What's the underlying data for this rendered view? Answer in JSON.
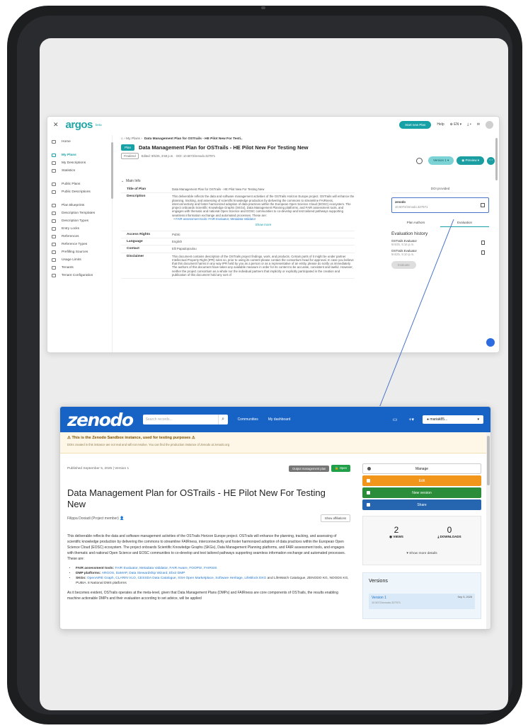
{
  "argos": {
    "logo": "argos",
    "beta": "beta",
    "start_plan": "Start new Plan",
    "help": "Help",
    "language": "EN",
    "sidebar": [
      {
        "label": "Home"
      },
      {
        "label": "My Plans",
        "active": true
      },
      {
        "label": "My Descriptions"
      },
      {
        "label": "Statistics"
      },
      {
        "label": "Public Plans"
      },
      {
        "label": "Public Descriptions"
      },
      {
        "label": "Plan Blueprints"
      },
      {
        "label": "Description Templates"
      },
      {
        "label": "Description Types"
      },
      {
        "label": "Entry Locks"
      },
      {
        "label": "References"
      },
      {
        "label": "Reference Types"
      },
      {
        "label": "Prefilling Sources"
      },
      {
        "label": "Usage Limits"
      },
      {
        "label": "Tenants"
      },
      {
        "label": "Tenant Configuration"
      }
    ],
    "breadcrumb": {
      "root": "My Plans",
      "current": "Data Management Plan for OSTrails - HE Pilot New For Testi.."
    },
    "plan_tag": "Plan",
    "plan_title": "Data Management Plan for OSTrails - HE Pilot New For Testing New",
    "status": "Finalized",
    "edited": "Edited: 9/5/25, 3:58 p.m.",
    "doi_line": "DOI: 10.5072/zenodo.327971",
    "version_btn": "Version 1",
    "preview_btn": "Preview",
    "main_info": "Main Info",
    "rows": [
      {
        "key": "Title of Plan",
        "value": "Data Management Plan for OSTrails - HE Pilot New For Testing New"
      },
      {
        "key": "Description",
        "value": "This deliverable reflects the data and software management activities of the OSTrails Horizon Europe project. OSTrails will enhance the planning, tracking, and assessing of scientific knowledge production by delivering the commons to streamline FAIRness, interconnectivity and foster harmonized adoption of data practices within the European Open Science Cloud (EOSC) ecosystem. The project onboards Scientific Knowledge Graphs (SKGs), Data Management Planning platforms, and FAIR assessment tools, and engages with thematic and national Open Science and EOSC communities to co-develop and test tailored pathways supporting seamless information exchange and automated processes. These are:",
        "bullet": "FAIR assessment tools: FAIR Evaluator, Metadata Validator"
      },
      {
        "key": "Access Rights",
        "value": "Public"
      },
      {
        "key": "Language",
        "value": "English"
      },
      {
        "key": "Contact",
        "value": "Elli Papadopoulou"
      },
      {
        "key": "Disclaimer",
        "value": "This document contains description of the OSTrails project findings, work, and products. Certain parts of it might be under partner Intellectual Property Right (IPR) rules so, prior to using its content please contact the consortium head for approval. In case you believe that this document harms in any way IPR held by you as a person or as a representative of an entity, please do notify us immediately. The authors of this document have taken any available measure in order for its content to be accurate, consistent and lawful. However, neither the project consortium as a whole nor the individual partners that implicitly or explicitly participated in the creation and publication of this document hold any sort of"
      }
    ],
    "show_more": "Show more",
    "doi_panel": {
      "header": "DOI provided",
      "repo": "zenodo",
      "doi": "10.5072/zenodo.327971",
      "tab_authors": "Plan Authors",
      "tab_eval": "Evaluation",
      "history_title": "Evaluation history",
      "items": [
        {
          "name": "OSTrails Evaluator",
          "date": "9/4/25, 5:16 p.m."
        },
        {
          "name": "OSTrails Evaluator",
          "date": "9/4/25, 5:10 p.m."
        }
      ],
      "evaluate_btn": "Evaluate"
    }
  },
  "zenodo": {
    "logo": "zenodo",
    "search_placeholder": "Search records...",
    "nav_communities": "Communities",
    "nav_dashboard": "My dashboard",
    "user": "mariak85...",
    "banner_title": "This is the Zenodo Sandbox instance, used for testing purposes",
    "banner_sub": "DOIs created in this instance are not real and will not resolve. You can find the production instance of Zenodo at zenodo.org",
    "published": "Published September 5, 2025 | Version 1",
    "badge_type": "Output management plan",
    "badge_open": "Open",
    "title": "Data Management Plan for OSTrails - HE Pilot New For Testing New",
    "creator": "Filippa Doxiadi (Project member)",
    "show_affiliations": "Show affiliations",
    "description": "This deliverable reflects the data and software management activities of the OSTrails Horizon Europe project. OSTrails will enhance the planning, tracking, and assessing of scientific knowledge production by delivering the commons to streamline FAIRness, interconnectivity and foster harmonized adoption of data practices within the European Open Science Cloud (EOSC) ecosystem. The project onboards Scientific Knowledge Graphs (SKGs), Data Management Planning platforms, and FAIR assessment tools, and engages with thematic and national Open Science and EOSC communities to co-develop and test tailored pathways supporting seamless information exchange and automated processes. These are:",
    "bullets": [
      {
        "lead": "FAIR assessment tools: ",
        "links": "FAIR Evaluator, Metadata Validator, FAIR Aware, FOOPS!, FAIRSIS"
      },
      {
        "lead": "DMP platforms: ",
        "links": "ARGOS, DaMAP, Data Stewardship Wizard, Elixir DMP"
      },
      {
        "lead": "SKGs: ",
        "links": "OpenAIRE Graph, CLARIN VLO, CESSDA Data Catalogue, SSH Open Marketplace, Software Heritage, LifeBlock EKG",
        "tail": "and LifeWatch Catalogue, ZENODO KG, NOODS KG, PUBIA. 8 National DMS platforms"
      }
    ],
    "description2": "As it becomes evident, OSTrails operates at the meta-level, given that Data Management Plans (DMPs) and FAIRness are core components of OSTrails, the results enabling machine actionable DMPs and their evaluation according to set advice, will be applied",
    "manage": "Manage",
    "edit": "Edit",
    "new_version": "New version",
    "share": "Share",
    "views_count": "2",
    "views_label": "VIEWS",
    "downloads_count": "0",
    "downloads_label": "DOWNLOADS",
    "show_more_details": "Show more details",
    "versions_title": "Versions",
    "version_label": "Version 1",
    "version_doi": "10.5072/zenodo.327971",
    "version_date": "Sep 5, 2025"
  },
  "colors": {
    "argos_teal": "#16a1a6",
    "zenodo_blue": "#1763c5",
    "edit_orange": "#f1961b",
    "new_green": "#2b8c3a",
    "share_blue": "#2666b0",
    "link_blue": "#1f74c9"
  }
}
